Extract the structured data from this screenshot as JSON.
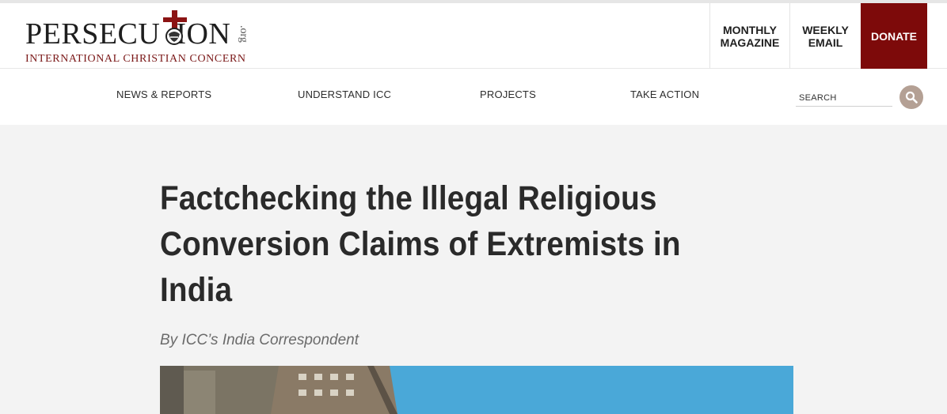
{
  "header": {
    "logo": {
      "main_text": "PERSECU  ION",
      "sub_text": "INTERNATIONAL CHRISTIAN CONCERN",
      "tld": ".org"
    },
    "buttons": {
      "monthly": [
        "MONTHLY",
        "MAGAZINE"
      ],
      "weekly": [
        "WEEKLY",
        "EMAIL"
      ],
      "donate": "DONATE"
    }
  },
  "nav": {
    "items": [
      "NEWS & REPORTS",
      "UNDERSTAND ICC",
      "PROJECTS",
      "TAKE ACTION"
    ],
    "search_placeholder": "SEARCH"
  },
  "article": {
    "title_lines": [
      "Factchecking the Illegal Religious",
      "Conversion Claims of Extremists in",
      "India"
    ],
    "byline": "By ICC’s India Correspondent"
  },
  "colors": {
    "brand_red": "#7d0a0a",
    "search_button": "#b4a094",
    "sky": "#3e9fd3"
  },
  "icons": {
    "cross": "cross-icon",
    "search": "search-icon"
  }
}
